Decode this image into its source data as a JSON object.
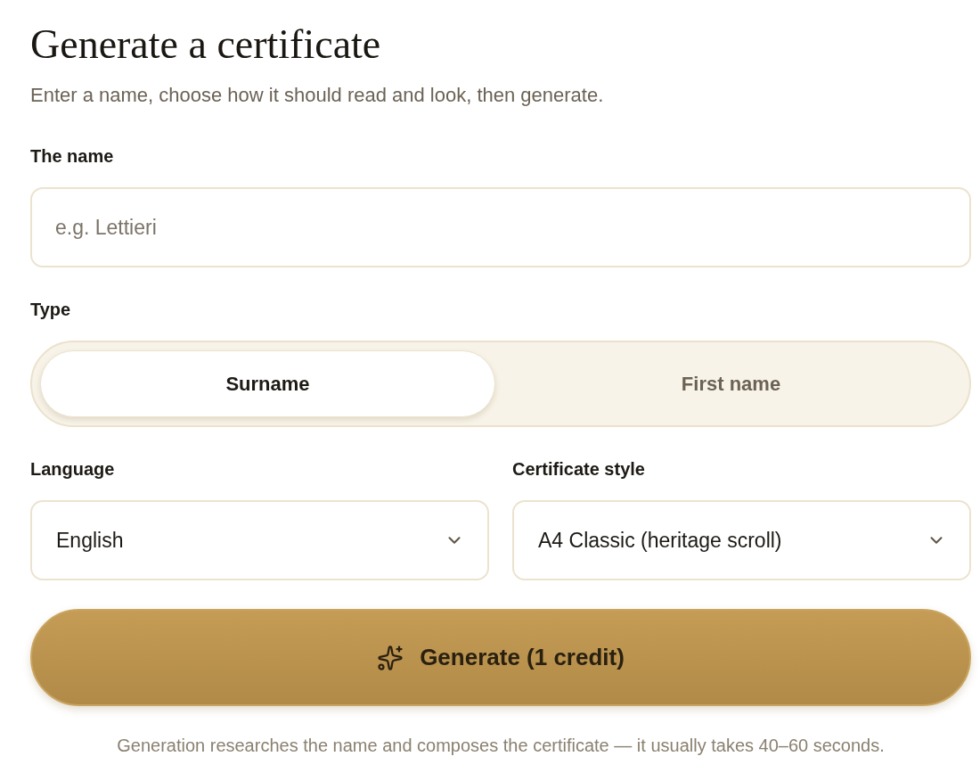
{
  "heading": {
    "title": "Generate a certificate",
    "subtitle": "Enter a name, choose how it should read and look, then generate."
  },
  "name_field": {
    "label": "The name",
    "placeholder": "e.g. Lettieri"
  },
  "type": {
    "label": "Type",
    "options": [
      {
        "label": "Surname",
        "selected": true
      },
      {
        "label": "First name",
        "selected": false
      }
    ]
  },
  "selects": [
    {
      "label": "Language",
      "value": "English"
    },
    {
      "label": "Certificate style",
      "value": "A4 Classic (heritage scroll)"
    }
  ],
  "generate_button": {
    "label": "Generate (1 credit)"
  },
  "note": "Generation researches the name and composes the certificate — it usually takes 40–60 seconds."
}
